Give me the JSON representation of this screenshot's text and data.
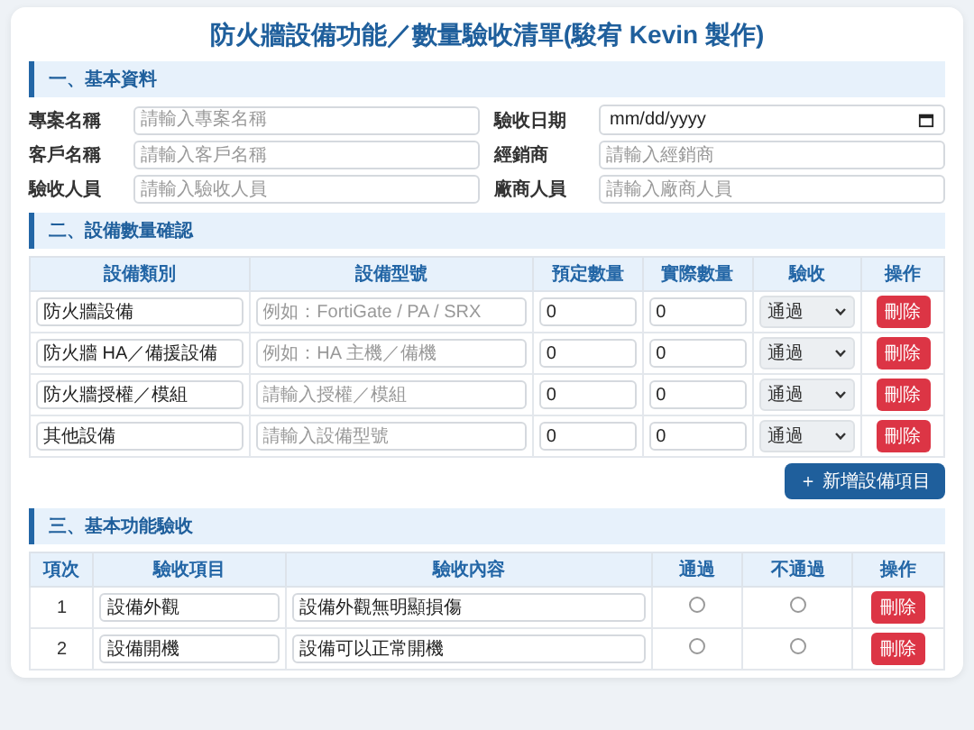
{
  "title": "防火牆設備功能／數量驗收清單(駿宥 Kevin 製作)",
  "basic": {
    "heading": "一、基本資料",
    "fields": [
      {
        "label": "專案名稱",
        "kind": "text",
        "placeholder": "請輸入專案名稱"
      },
      {
        "label": "驗收日期",
        "kind": "date",
        "value": "mm/dd/yyyy"
      },
      {
        "label": "客戶名稱",
        "kind": "text",
        "placeholder": "請輸入客戶名稱"
      },
      {
        "label": "經銷商",
        "kind": "text",
        "placeholder": "請輸入經銷商"
      },
      {
        "label": "驗收人員",
        "kind": "text",
        "placeholder": "請輸入驗收人員"
      },
      {
        "label": "廠商人員",
        "kind": "text",
        "placeholder": "請輸入廠商人員"
      }
    ]
  },
  "equipment": {
    "heading": "二、設備數量確認",
    "columns": [
      "設備類別",
      "設備型號",
      "預定數量",
      "實際數量",
      "驗收",
      "操作"
    ],
    "rows": [
      {
        "category": "防火牆設備",
        "model_placeholder": "例如：FortiGate / PA / SRX",
        "planned": "0",
        "actual": "0",
        "result": "通過",
        "action": "刪除"
      },
      {
        "category": "防火牆 HA／備援設備",
        "model_placeholder": "例如：HA 主機／備機",
        "planned": "0",
        "actual": "0",
        "result": "通過",
        "action": "刪除"
      },
      {
        "category": "防火牆授權／模組",
        "model_placeholder": "請輸入授權／模組",
        "planned": "0",
        "actual": "0",
        "result": "通過",
        "action": "刪除"
      },
      {
        "category": "其他設備",
        "model_placeholder": "請輸入設備型號",
        "planned": "0",
        "actual": "0",
        "result": "通過",
        "action": "刪除"
      }
    ],
    "add_button": "＋ 新增設備項目"
  },
  "functions": {
    "heading": "三、基本功能驗收",
    "columns": [
      "項次",
      "驗收項目",
      "驗收內容",
      "通過",
      "不通過",
      "操作"
    ],
    "rows": [
      {
        "index": "1",
        "item": "設備外觀",
        "content": "設備外觀無明顯損傷",
        "radios": [
          {
            "selected": false
          },
          {
            "selected": false
          }
        ],
        "action": "刪除"
      },
      {
        "index": "2",
        "item": "設備開機",
        "content": "設備可以正常開機",
        "radios": [
          {
            "selected": false
          },
          {
            "selected": false
          }
        ],
        "action": "刪除"
      }
    ]
  }
}
